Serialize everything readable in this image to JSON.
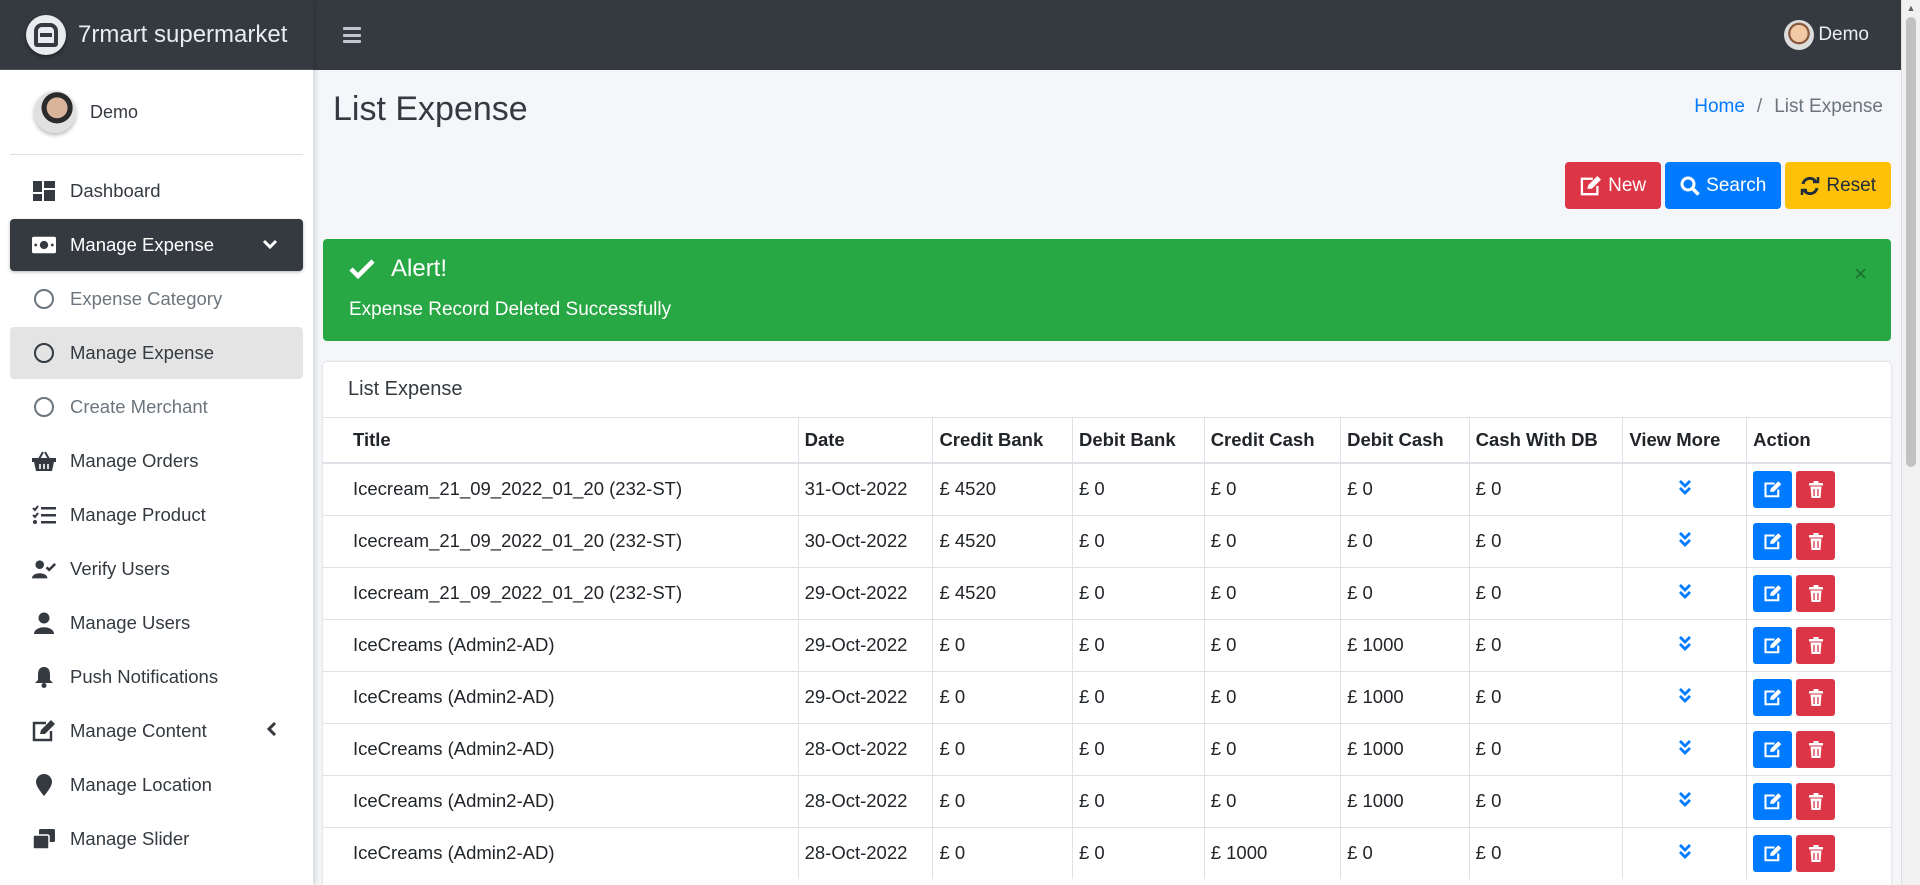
{
  "brand": {
    "name": "7rmart supermarket"
  },
  "sidebar": {
    "user": "Demo",
    "items": [
      {
        "label": "Dashboard",
        "icon": "dashboard-icon"
      },
      {
        "label": "Manage Expense",
        "icon": "money-bill-icon"
      },
      {
        "label": "Expense Category",
        "icon": "circle-icon"
      },
      {
        "label": "Manage Expense",
        "icon": "circle-icon"
      },
      {
        "label": "Create Merchant",
        "icon": "circle-icon"
      },
      {
        "label": "Manage Orders",
        "icon": "basket-icon"
      },
      {
        "label": "Manage Product",
        "icon": "tasks-icon"
      },
      {
        "label": "Verify Users",
        "icon": "user-check-icon"
      },
      {
        "label": "Manage Users",
        "icon": "user-icon"
      },
      {
        "label": "Push Notifications",
        "icon": "bell-icon"
      },
      {
        "label": "Manage Content",
        "icon": "edit-icon"
      },
      {
        "label": "Manage Location",
        "icon": "map-marker-icon"
      },
      {
        "label": "Manage Slider",
        "icon": "window-restore-icon"
      }
    ]
  },
  "header": {
    "user": "Demo"
  },
  "page": {
    "title": "List Expense",
    "breadcrumb": {
      "home": "Home",
      "current": "List Expense"
    },
    "buttons": {
      "new": "New",
      "search": "Search",
      "reset": "Reset"
    }
  },
  "alert": {
    "title": "Alert!",
    "message": "Expense Record Deleted Successfully",
    "close": "×"
  },
  "table": {
    "card_title": "List Expense",
    "columns": [
      "Title",
      "Date",
      "Credit Bank",
      "Debit Bank",
      "Credit Cash",
      "Debit Cash",
      "Cash With DB",
      "View More",
      "Action"
    ],
    "rows": [
      [
        "Icecream_21_09_2022_01_20 (232-ST)",
        "31-Oct-2022",
        "£ 4520",
        "£ 0",
        "£ 0",
        "£ 0",
        "£ 0"
      ],
      [
        "Icecream_21_09_2022_01_20 (232-ST)",
        "30-Oct-2022",
        "£ 4520",
        "£ 0",
        "£ 0",
        "£ 0",
        "£ 0"
      ],
      [
        "Icecream_21_09_2022_01_20 (232-ST)",
        "29-Oct-2022",
        "£ 4520",
        "£ 0",
        "£ 0",
        "£ 0",
        "£ 0"
      ],
      [
        "IceCreams (Admin2-AD)",
        "29-Oct-2022",
        "£ 0",
        "£ 0",
        "£ 0",
        "£ 1000",
        "£ 0"
      ],
      [
        "IceCreams (Admin2-AD)",
        "29-Oct-2022",
        "£ 0",
        "£ 0",
        "£ 0",
        "£ 1000",
        "£ 0"
      ],
      [
        "IceCreams (Admin2-AD)",
        "28-Oct-2022",
        "£ 0",
        "£ 0",
        "£ 0",
        "£ 1000",
        "£ 0"
      ],
      [
        "IceCreams (Admin2-AD)",
        "28-Oct-2022",
        "£ 0",
        "£ 0",
        "£ 0",
        "£ 1000",
        "£ 0"
      ],
      [
        "IceCreams (Admin2-AD)",
        "28-Oct-2022",
        "£ 0",
        "£ 0",
        "£ 1000",
        "£ 0",
        "£ 0"
      ]
    ]
  },
  "colors": {
    "sidebar_dark": "#343a40",
    "danger": "#dc3545",
    "primary": "#007bff",
    "warning": "#ffc107",
    "success": "#28a745"
  }
}
